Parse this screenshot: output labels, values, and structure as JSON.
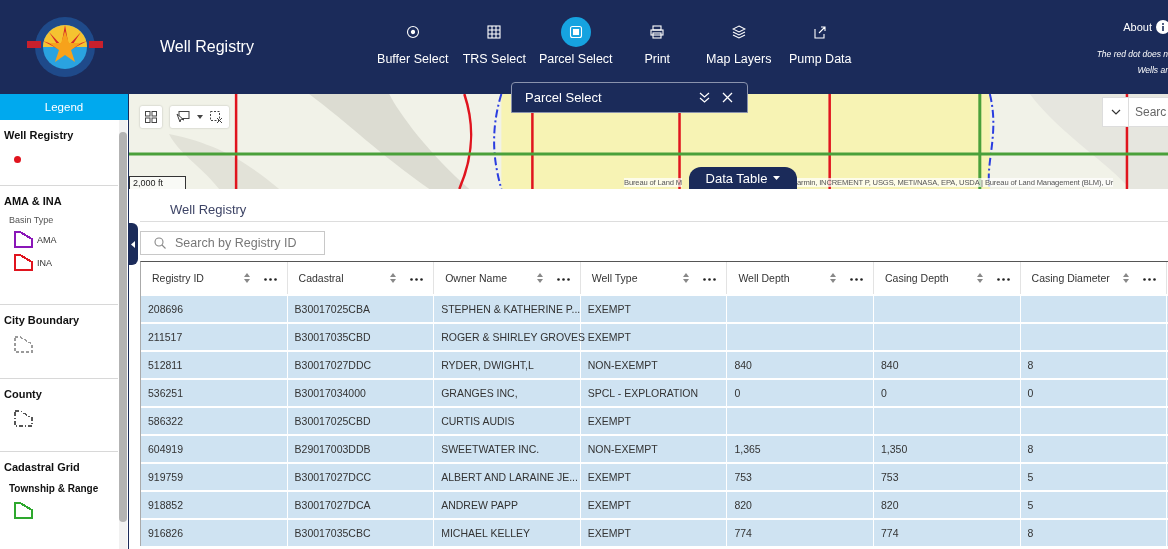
{
  "header": {
    "title": "Well Registry",
    "nav": [
      {
        "label": "Buffer Select",
        "selected": false
      },
      {
        "label": "TRS Select",
        "selected": false
      },
      {
        "label": "Parcel Select",
        "selected": true
      },
      {
        "label": "Print",
        "selected": false
      },
      {
        "label": "Map Layers",
        "selected": false
      },
      {
        "label": "Pump Data",
        "selected": false
      }
    ],
    "about": "About",
    "notice_lines": [
      "The red dot does n",
      "Wells ar"
    ]
  },
  "legend": {
    "title": "Legend",
    "sections": [
      {
        "title": "Well Registry",
        "items": [
          {
            "kind": "dot",
            "color": "#e0141e"
          }
        ]
      },
      {
        "title": "AMA & INA",
        "subtitle": {
          "text": "Basin Type",
          "kind": "caption"
        },
        "items": [
          {
            "kind": "solid",
            "color": "#8a16b8",
            "label": "AMA"
          },
          {
            "kind": "solid",
            "color": "#e0141e",
            "label": "INA"
          }
        ]
      },
      {
        "title": "City Boundary",
        "items": [
          {
            "kind": "dashed",
            "color": "#9a9a9a"
          }
        ]
      },
      {
        "title": "County",
        "items": [
          {
            "kind": "dashdot",
            "color": "#555555"
          }
        ]
      },
      {
        "title": "Cadastral Grid",
        "subtitle": {
          "text": "Township & Range",
          "kind": "heading"
        },
        "items": [
          {
            "kind": "solid",
            "color": "#2ea82e"
          }
        ]
      }
    ]
  },
  "map": {
    "scale": "2,000 ft",
    "attribution": [
      "Bureau of Land M",
      "armin, INCREMENT P, USGS, METI/NASA, EPA, USDA | Bureau of Land Management (BLM), Ur"
    ],
    "search_placeholder": "Searc",
    "data_table_tab": "Data Table",
    "panel": {
      "title": "Parcel Select"
    }
  },
  "table": {
    "title": "Well Registry",
    "search_placeholder": "Search by Registry ID",
    "columns": [
      "Registry ID",
      "Cadastral",
      "Owner Name",
      "Well Type",
      "Well Depth",
      "Casing Depth",
      "Casing Diameter"
    ],
    "rows": [
      {
        "selected": true,
        "cells": [
          "208696",
          "B30017025CBA",
          "STEPHEN & KATHERINE P...",
          "EXEMPT",
          null,
          null,
          null
        ]
      },
      {
        "selected": true,
        "cells": [
          "211517",
          "B30017035CBD",
          "ROGER & SHIRLEY GROVES",
          "EXEMPT",
          null,
          null,
          null
        ]
      },
      {
        "selected": true,
        "cells": [
          "512811",
          "B30017027DDC",
          "RYDER, DWIGHT,L",
          "NON-EXEMPT",
          "840",
          "840",
          "8"
        ]
      },
      {
        "selected": true,
        "cells": [
          "536251",
          "B30017034000",
          "GRANGES INC,",
          "SPCL - EXPLORATION",
          "0",
          "0",
          "0"
        ]
      },
      {
        "selected": true,
        "cells": [
          "586322",
          "B30017025CBD",
          "CURTIS AUDIS",
          "EXEMPT",
          null,
          null,
          null
        ]
      },
      {
        "selected": true,
        "cells": [
          "604919",
          "B29017003DDB",
          "SWEETWATER INC.",
          "NON-EXEMPT",
          "1,365",
          "1,350",
          "8"
        ]
      },
      {
        "selected": true,
        "cells": [
          "919759",
          "B30017027DCC",
          "ALBERT AND LARAINE JE...",
          "EXEMPT",
          "753",
          "753",
          "5"
        ]
      },
      {
        "selected": true,
        "cells": [
          "918852",
          "B30017027DCA",
          "ANDREW PAPP",
          "EXEMPT",
          "820",
          "820",
          "5"
        ]
      },
      {
        "selected": true,
        "cells": [
          "916826",
          "B30017035CBC",
          "MICHAEL KELLEY",
          "EXEMPT",
          "774",
          "774",
          "8"
        ]
      }
    ]
  }
}
